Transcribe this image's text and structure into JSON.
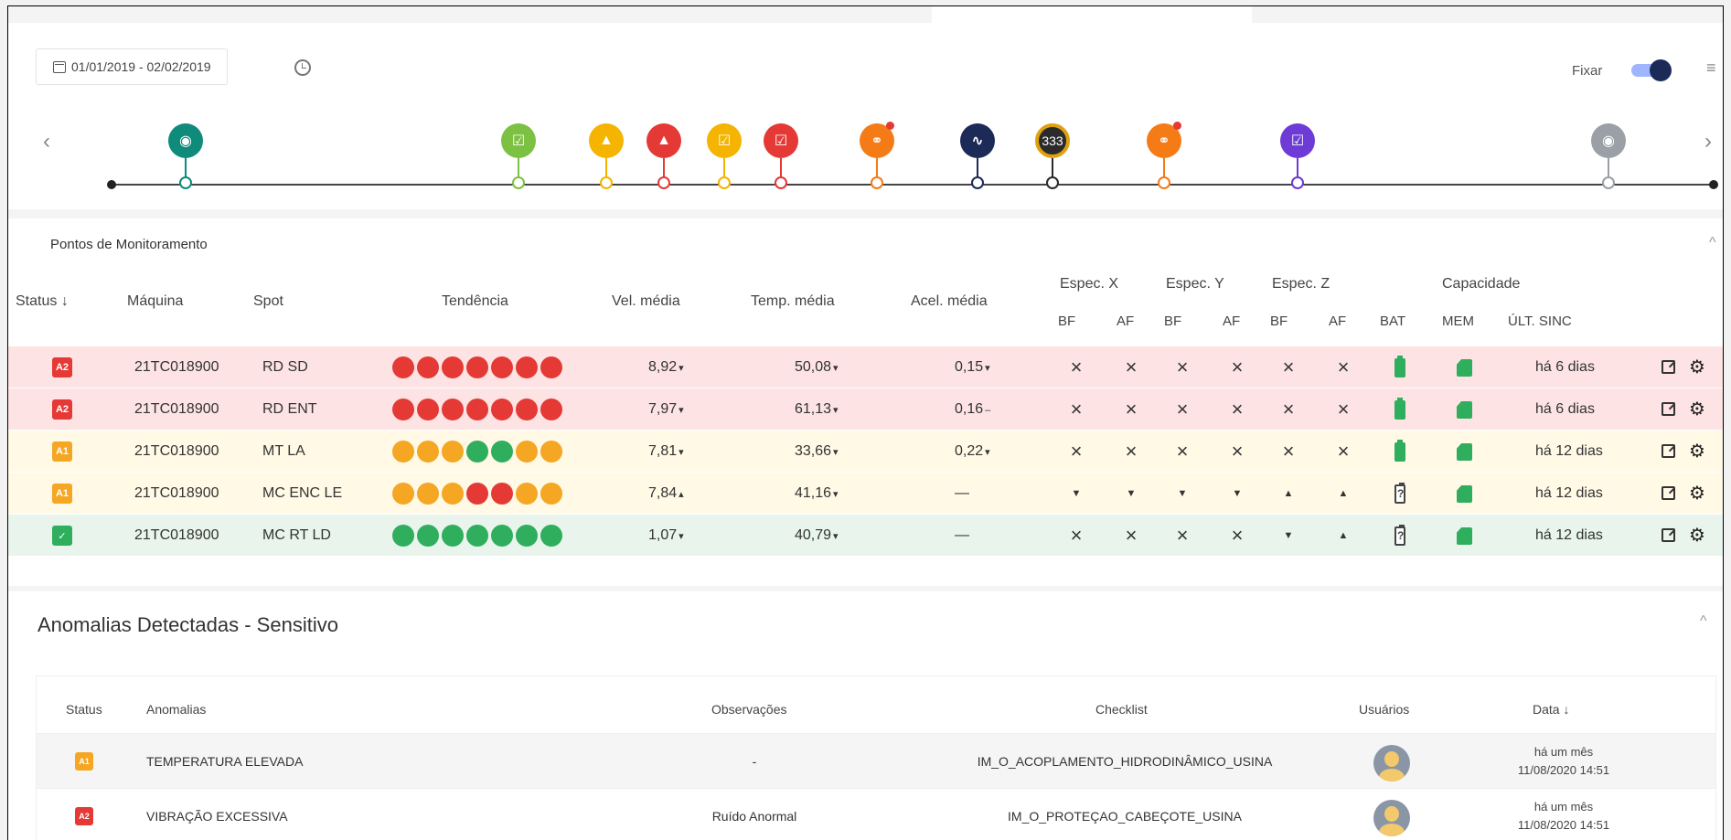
{
  "colors": {
    "a2_red": "#e53935",
    "a1_amber": "#f5a623",
    "ok_green": "#2fae5d",
    "row_red_bg": "#fde3e3",
    "row_yellow_bg": "#fff9e6",
    "row_green_bg": "#e8f4ec",
    "timeline_teal": "#0f8b7c",
    "timeline_navy": "#1c2a57",
    "timeline_purple": "#6e3bd6",
    "timeline_orange": "#f47b16",
    "timeline_gray": "#9aa0a6"
  },
  "header": {
    "date_range": "01/01/2019 - 02/02/2019",
    "fixar_label": "Fixar",
    "fixar_on": true
  },
  "timeline": {
    "events": [
      {
        "color": "#0f8b7c",
        "icon": "target-icon"
      },
      {
        "color": "#7cc142",
        "icon": "checklist-icon"
      },
      {
        "color": "#f5b400",
        "icon": "warning-icon"
      },
      {
        "color": "#e53935",
        "icon": "warning-icon"
      },
      {
        "color": "#f5b400",
        "icon": "checklist-icon"
      },
      {
        "color": "#e53935",
        "icon": "checklist-icon"
      },
      {
        "color": "#f47b16",
        "icon": "share-icon",
        "badge": true
      },
      {
        "color": "#1c2a57",
        "icon": "pulse-icon"
      },
      {
        "color": "#2b2b2b",
        "icon": "count-icon",
        "text": "333"
      },
      {
        "color": "#f47b16",
        "icon": "share-icon",
        "badge": true
      },
      {
        "color": "#6e3bd6",
        "icon": "checklist-icon"
      },
      {
        "color": "#9aa0a6",
        "icon": "target-icon"
      }
    ]
  },
  "monitoring": {
    "title": "Pontos de Monitoramento",
    "headers": {
      "status": "Status",
      "machine": "Máquina",
      "spot": "Spot",
      "trend": "Tendência",
      "vel": "Vel. média",
      "temp": "Temp. média",
      "acel": "Acel. média",
      "spec_x": "Espec. X",
      "spec_y": "Espec. Y",
      "spec_z": "Espec. Z",
      "capacity": "Capacidade",
      "bf": "BF",
      "af": "AF",
      "bat": "BAT",
      "mem": "MEM",
      "last_sync": "ÚLT. SINC"
    },
    "rows": [
      {
        "status": "A2",
        "machine": "21TC018900",
        "spot": "RD SD",
        "trend": [
          "r",
          "r",
          "r",
          "r",
          "r",
          "r",
          "r"
        ],
        "vel": "8,92",
        "vel_arrow": "▾",
        "temp": "50,08",
        "temp_arrow": "▾",
        "acel": "0,15",
        "acel_arrow": "▾",
        "spec": [
          "x",
          "x",
          "x",
          "x",
          "x",
          "x"
        ],
        "bat": "full",
        "last_sync": "há 6 dias"
      },
      {
        "status": "A2",
        "machine": "21TC018900",
        "spot": "RD ENT",
        "trend": [
          "r",
          "r",
          "r",
          "r",
          "r",
          "r",
          "r"
        ],
        "vel": "7,97",
        "vel_arrow": "▾",
        "temp": "61,13",
        "temp_arrow": "▾",
        "acel": "0,16",
        "acel_arrow": "–",
        "spec": [
          "x",
          "x",
          "x",
          "x",
          "x",
          "x"
        ],
        "bat": "full",
        "last_sync": "há 6 dias"
      },
      {
        "status": "A1",
        "machine": "21TC018900",
        "spot": "MT LA",
        "trend": [
          "y",
          "y",
          "y",
          "g",
          "g",
          "y",
          "y"
        ],
        "vel": "7,81",
        "vel_arrow": "▾",
        "temp": "33,66",
        "temp_arrow": "▾",
        "acel": "0,22",
        "acel_arrow": "▾",
        "spec": [
          "x",
          "x",
          "x",
          "x",
          "x",
          "x"
        ],
        "bat": "full",
        "last_sync": "há 12 dias"
      },
      {
        "status": "A1",
        "machine": "21TC018900",
        "spot": "MC ENC LE",
        "trend": [
          "y",
          "y",
          "y",
          "r",
          "r",
          "y",
          "y"
        ],
        "vel": "7,84",
        "vel_arrow": "▴",
        "temp": "41,16",
        "temp_arrow": "▾",
        "acel": "—",
        "acel_arrow": "",
        "spec": [
          "down",
          "down",
          "down",
          "down",
          "up",
          "up"
        ],
        "bat": "unknown",
        "last_sync": "há 12 dias"
      },
      {
        "status": "OK",
        "machine": "21TC018900",
        "spot": "MC RT LD",
        "trend": [
          "g",
          "g",
          "g",
          "g",
          "g",
          "g",
          "g"
        ],
        "vel": "1,07",
        "vel_arrow": "▾",
        "temp": "40,79",
        "temp_arrow": "▾",
        "acel": "—",
        "acel_arrow": "",
        "spec": [
          "x",
          "x",
          "x",
          "x",
          "down",
          "up"
        ],
        "bat": "unknown",
        "last_sync": "há 12 dias"
      }
    ]
  },
  "anomalies": {
    "title": "Anomalias Detectadas - Sensitivo",
    "headers": {
      "status": "Status",
      "anomaly": "Anomalias",
      "obs": "Observações",
      "checklist": "Checklist",
      "users": "Usuários",
      "date": "Data ↓"
    },
    "rows": [
      {
        "status": "A1",
        "anomaly": "TEMPERATURA ELEVADA",
        "obs": "-",
        "checklist": "IM_O_ACOPLAMENTO_HIDRODINÂMICO_USINA",
        "date_rel": "há um mês",
        "date_abs": "11/08/2020 14:51"
      },
      {
        "status": "A2",
        "anomaly": "VIBRAÇÃO EXCESSIVA",
        "obs": "Ruído Anormal",
        "checklist": "IM_O_PROTEÇAO_CABEÇOTE_USINA",
        "date_rel": "há um mês",
        "date_abs": "11/08/2020 14:51"
      }
    ]
  }
}
